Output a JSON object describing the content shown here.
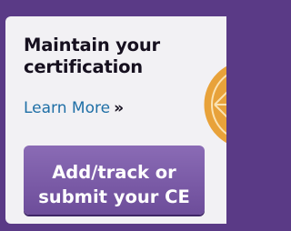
{
  "card": {
    "heading_line1": "Maintain your",
    "heading_line2": "certification",
    "learn_more": "Learn More",
    "learn_more_arrow": "»",
    "cta_line1": "Add/track or",
    "cta_line2": "submit your CE"
  },
  "colors": {
    "brand_purple": "#5a3a86",
    "button_purple": "#7b5aa8",
    "link_blue": "#1f6fa6",
    "badge_orange": "#e8a23a"
  }
}
